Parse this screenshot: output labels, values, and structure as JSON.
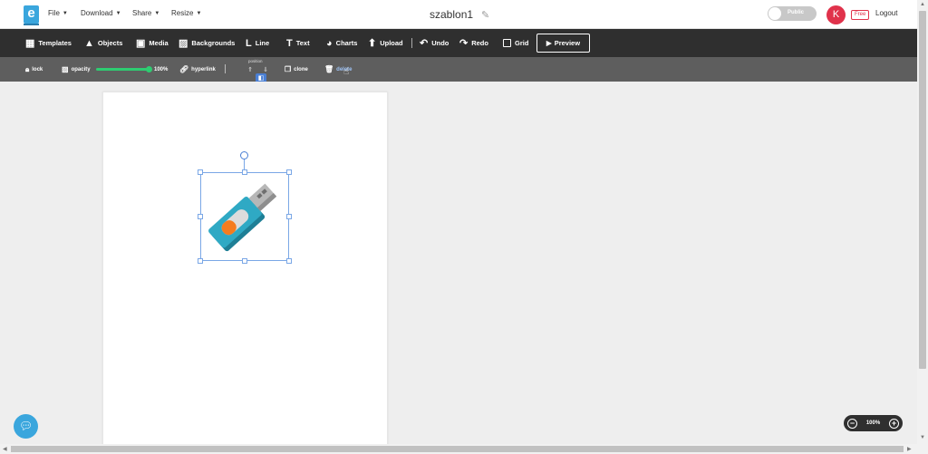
{
  "app": {
    "logo_letter": "e",
    "doc_title": "szablon1"
  },
  "menus": [
    {
      "label": "File"
    },
    {
      "label": "Download"
    },
    {
      "label": "Share"
    },
    {
      "label": "Resize"
    }
  ],
  "header": {
    "visibility_label": "Public",
    "avatar_initial": "K",
    "plan_badge": "Free",
    "logout_label": "Logout"
  },
  "toolbar": {
    "templates": "Templates",
    "objects": "Objects",
    "media": "Media",
    "backgrounds": "Backgrounds",
    "line": "Line",
    "text": "Text",
    "charts": "Charts",
    "upload": "Upload",
    "undo": "Undo",
    "redo": "Redo",
    "grid": "Grid",
    "preview": "Preview"
  },
  "context": {
    "lock": "lock",
    "opacity": "opacity",
    "opacity_value": "100%",
    "opacity_level": 1.0,
    "hyperlink": "hyperlink",
    "layer_label": "position",
    "clone": "clone",
    "delete": "delete"
  },
  "canvas": {
    "selected_object": "usb-flash-drive"
  },
  "zoom": {
    "level": "100%"
  },
  "colors": {
    "accent": "#3aa6dd",
    "toolbar": "#2f2f2f",
    "context_bar": "#5e5e5e",
    "avatar": "#e0324b",
    "slider": "#2ecc71",
    "selection": "#7aa7e6"
  }
}
